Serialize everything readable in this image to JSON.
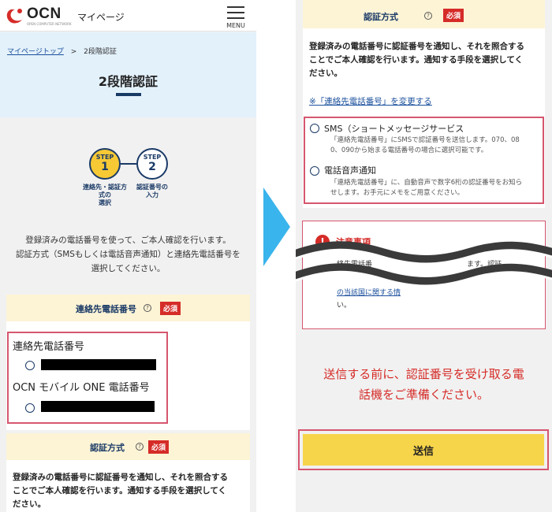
{
  "header": {
    "logo_text": "OCN",
    "logo_sub": "OPEN COMPUTER NETWORK",
    "mypage_label": "マイページ",
    "menu_label": "MENU"
  },
  "breadcrumb": {
    "home": "マイページトップ",
    "separator": ">",
    "current": "2段階認証"
  },
  "page_title": "2段階認証",
  "steps": [
    {
      "step_label": "STEP",
      "number": "1",
      "caption_lines": [
        "連絡先・認証方",
        "式の",
        "選択"
      ]
    },
    {
      "step_label": "STEP",
      "number": "2",
      "caption_lines": [
        "認証番号の",
        "入力"
      ]
    }
  ],
  "intro_lines": [
    "登録済みの電話番号を使って、ご本人確認を行います。",
    "認証方式（SMSもしくは電話音声通知）と連絡先電話番号を",
    "選択してください。"
  ],
  "contact_section": {
    "title": "連絡先電話番号",
    "required": "必須",
    "options": [
      {
        "label": "連絡先電話番号"
      },
      {
        "label": "OCN モバイル ONE 電話番号"
      }
    ]
  },
  "auth_section": {
    "title": "認証方式",
    "required": "必須",
    "description_lines": [
      "登録済みの電話番号に認証番号を通知し、それを照合する",
      "ことでご本人確認を行います。通知する手段を選択してく",
      "ださい。"
    ]
  },
  "right": {
    "auth_title": "認証方式",
    "required": "必須",
    "description_lines": [
      "登録済みの電話番号に認証番号を通知し、それを照合する",
      "ことでご本人確認を行います。通知する手段を選択してく",
      "ださい。"
    ],
    "change_link": "※「連絡先電話番号」を変更する",
    "methods": [
      {
        "title": "SMS（ショートメッセージサービス",
        "desc_lines": [
          "「連絡先電話番号」にSMSで認証番号を送信します。070、08",
          "0、090から始まる電話番号の場合に選択可能です。"
        ]
      },
      {
        "title": "電話音声通知",
        "desc_lines": [
          "「連絡先電話番号」に、自動音声で数字6桁の認証番号をお知ら",
          "せします。お手元にメモをご用意ください。"
        ]
      }
    ],
    "notice_title": "注意事項",
    "notice_icon": "!",
    "notice_fragments": [
      "絡先電話番",
      "ます。認証",
      "の当該国に関する情",
      "い。"
    ],
    "warning_lines": [
      "送信する前に、認証番号を受け取る電",
      "話機をご準備ください。"
    ],
    "submit_label": "送信"
  },
  "colors": {
    "accent_yellow": "#f7c935",
    "navy": "#1a3a66",
    "required_red": "#d52c28",
    "highlight_border": "#d6566e",
    "band_blue": "#e3f1fb",
    "arrow_blue": "#3ab4ec"
  }
}
